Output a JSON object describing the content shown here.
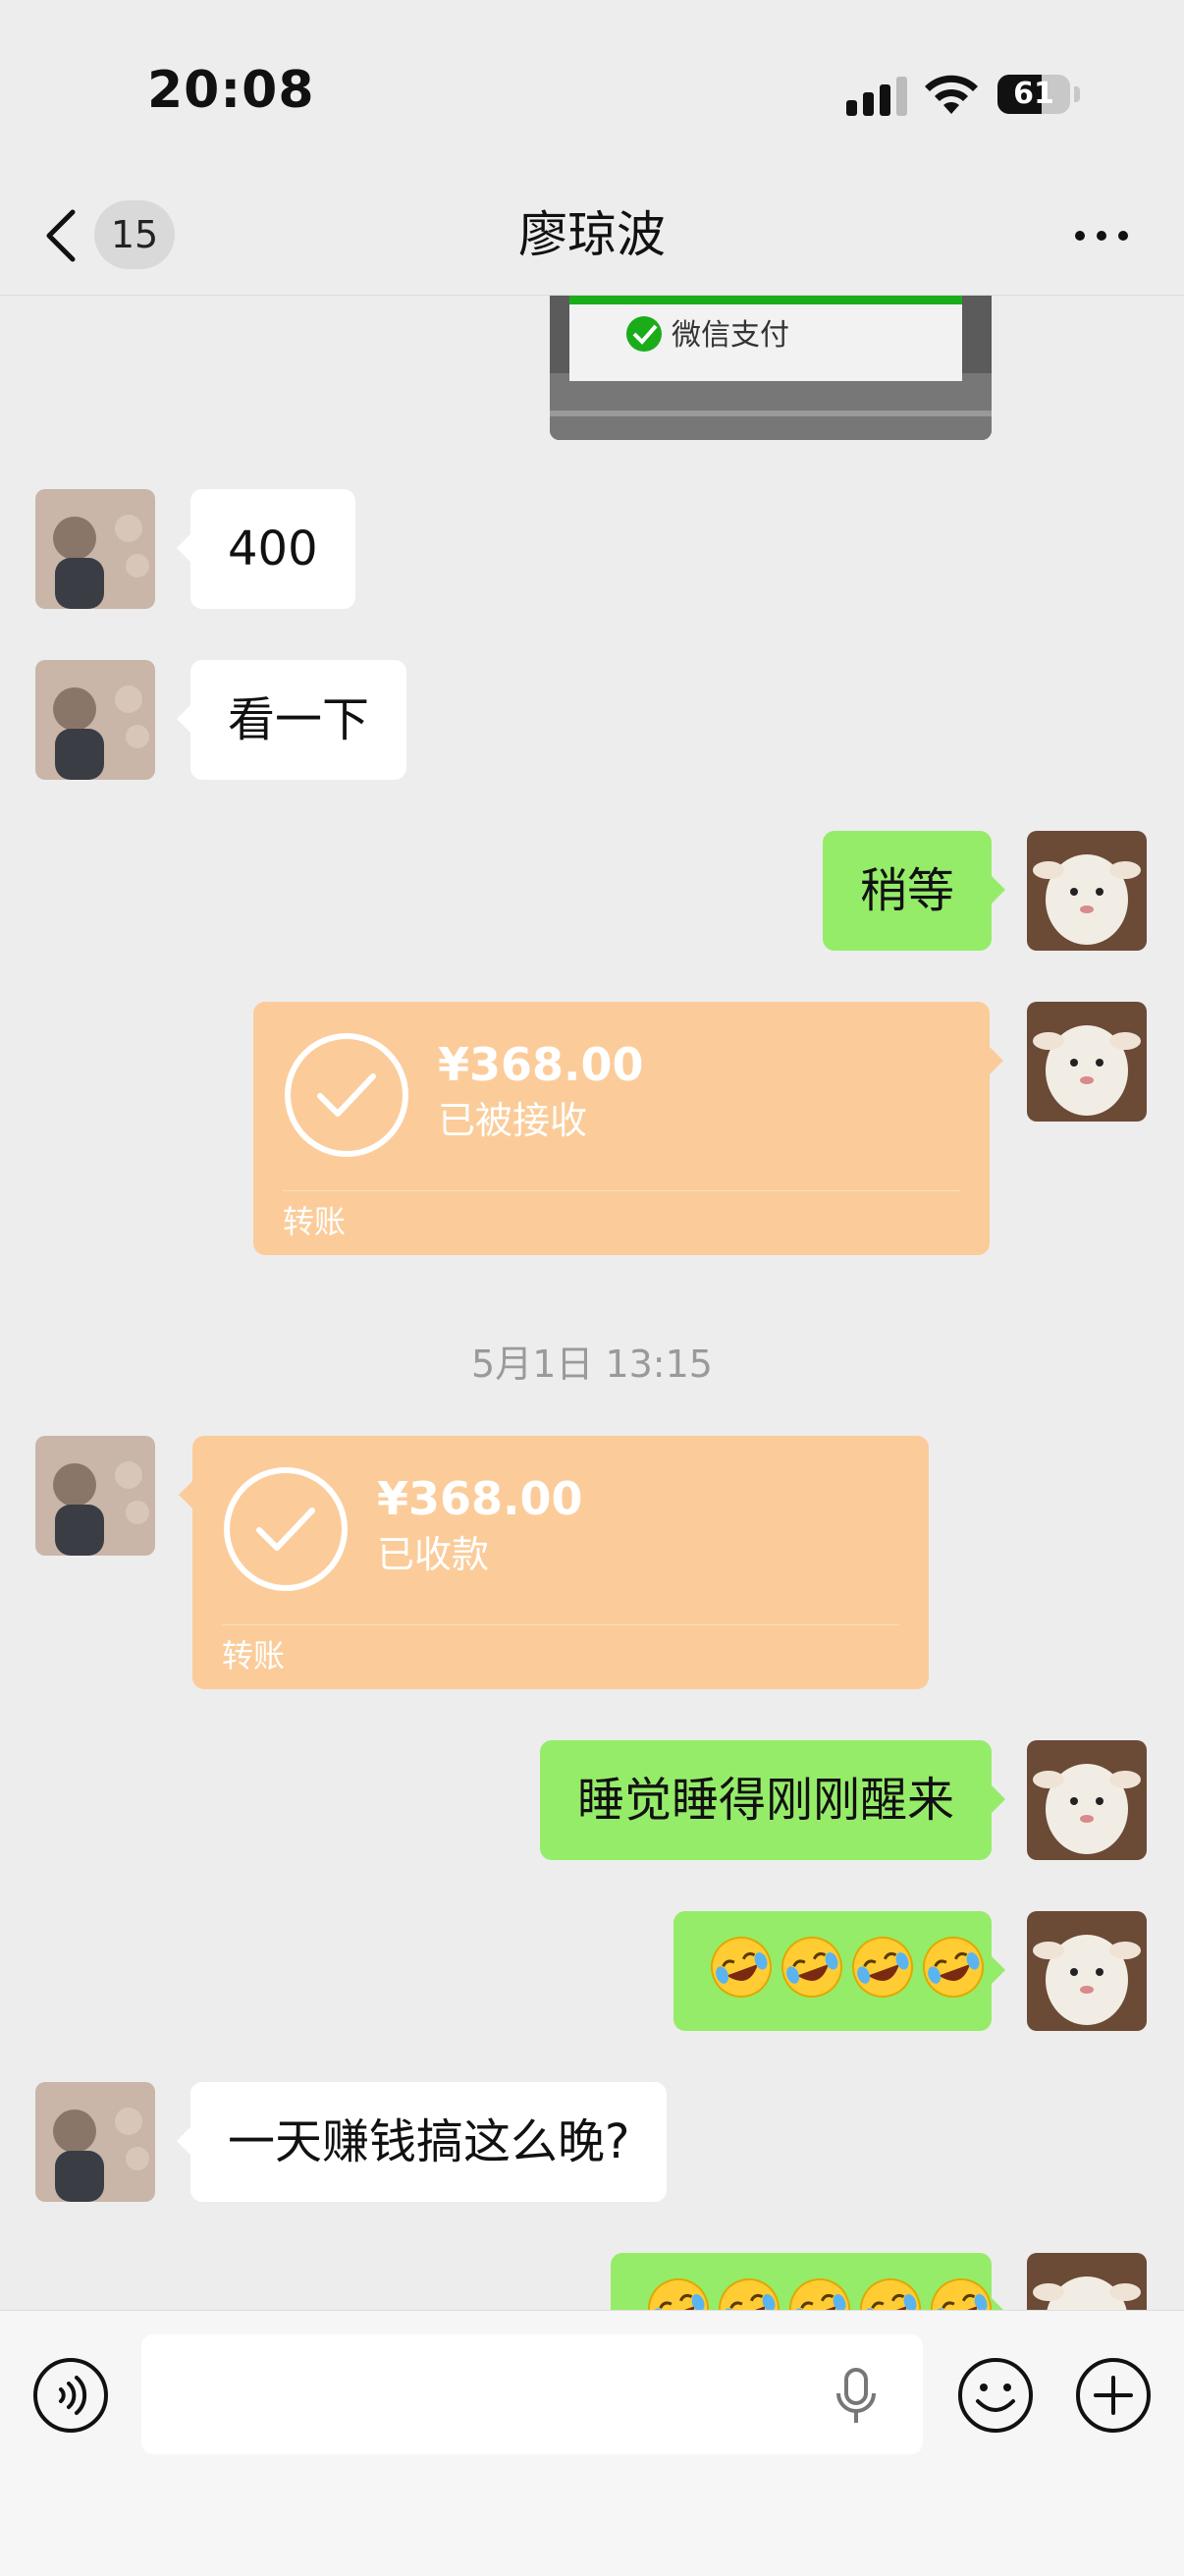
{
  "status_bar": {
    "time": "20:08",
    "battery": "61",
    "battery_level": 0.61
  },
  "nav": {
    "unread_count": "15",
    "title": "廖琼波",
    "more_icon": "more-icon",
    "back_icon": "chevron-left-icon"
  },
  "photo_message": {
    "sign_text": "微信支付"
  },
  "messages": {
    "m1": {
      "side": "in",
      "text": "400"
    },
    "m2": {
      "side": "in",
      "text": "看一下"
    },
    "m3": {
      "side": "out",
      "text": "稍等"
    },
    "m4": {
      "side": "out",
      "type": "transfer",
      "amount": "¥368.00",
      "status": "已被接收",
      "kind": "转账"
    },
    "m5": {
      "side": "in",
      "type": "transfer",
      "amount": "¥368.00",
      "status": "已收款",
      "kind": "转账"
    },
    "m6": {
      "side": "out",
      "text": "睡觉睡得刚刚醒来"
    },
    "m7": {
      "side": "out",
      "type": "emoji",
      "count": 4,
      "emoji_name": "rolling-on-floor-laughing-icon"
    },
    "m8": {
      "side": "in",
      "text": "一天赚钱搞这么晚?"
    },
    "m9": {
      "side": "out",
      "type": "emoji",
      "count": 5,
      "emoji_name": "rolling-on-floor-laughing-icon"
    }
  },
  "timestamp": "5月1日 13:15",
  "input_bar": {
    "placeholder": "",
    "icons": [
      "voice-icon",
      "microphone-icon",
      "emoji-icon",
      "plus-icon"
    ]
  },
  "colors": {
    "background": "#ededed",
    "outgoing_bubble": "#95ec69",
    "incoming_bubble": "#ffffff",
    "transfer_card": "#fbcc9a"
  }
}
